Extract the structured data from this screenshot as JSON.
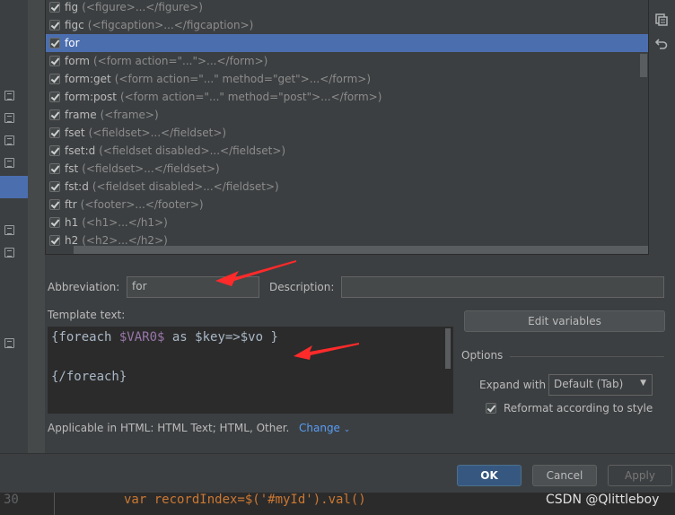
{
  "templates": [
    {
      "abbr": "fig",
      "desc": "(<figure>...</figure>)",
      "checked": true
    },
    {
      "abbr": "figc",
      "desc": "(<figcaption>...</figcaption>)",
      "checked": true
    },
    {
      "abbr": "for",
      "desc": "",
      "checked": true,
      "selected": true
    },
    {
      "abbr": "form",
      "desc": "(<form action=\"...\">...</form>)",
      "checked": true
    },
    {
      "abbr": "form:get",
      "desc": "(<form action=\"...\" method=\"get\">...</form>)",
      "checked": true
    },
    {
      "abbr": "form:post",
      "desc": "(<form action=\"...\" method=\"post\">...</form>)",
      "checked": true
    },
    {
      "abbr": "frame",
      "desc": "(<frame>)",
      "checked": true
    },
    {
      "abbr": "fset",
      "desc": "(<fieldset>...</fieldset>)",
      "checked": true
    },
    {
      "abbr": "fset:d",
      "desc": "(<fieldset disabled>...</fieldset>)",
      "checked": true
    },
    {
      "abbr": "fst",
      "desc": "(<fieldset>...</fieldset>)",
      "checked": true
    },
    {
      "abbr": "fst:d",
      "desc": "(<fieldset disabled>...</fieldset>)",
      "checked": true
    },
    {
      "abbr": "ftr",
      "desc": "(<footer>...</footer>)",
      "checked": true
    },
    {
      "abbr": "h1",
      "desc": "(<h1>...</h1>)",
      "checked": true
    },
    {
      "abbr": "h2",
      "desc": "(<h2>...</h2>)",
      "checked": true
    }
  ],
  "toolbar": {
    "copy_icon": "copy-icon",
    "revert_icon": "undo-icon"
  },
  "form": {
    "abbreviation_label": "Abbreviation:",
    "abbreviation_value": "for",
    "description_label": "Description:",
    "description_value": "",
    "template_text_label": "Template text:",
    "template_line1_a": "{foreach ",
    "template_line1_var": "$VAR0$",
    "template_line1_b": " as $key=>$vo }",
    "template_line3": "{/foreach}",
    "edit_variables": "Edit variables",
    "applicable": "Applicable in HTML: HTML Text; HTML, Other.",
    "change": "Change"
  },
  "options": {
    "title": "Options",
    "expand_label": "Expand with",
    "expand_value": "Default (Tab)",
    "reformat_label": "Reformat according to style",
    "reformat_checked": true
  },
  "buttons": {
    "ok": "OK",
    "cancel": "Cancel",
    "apply": "Apply"
  },
  "background_code": {
    "line_number": "30",
    "code": "var recordIndex=$('#myId').val()"
  },
  "watermark": "CSDN @Qlittleboy",
  "colors": {
    "selection": "#4b6eaf",
    "annotation_arrow": "#ff2a2a",
    "link": "#589df6"
  }
}
